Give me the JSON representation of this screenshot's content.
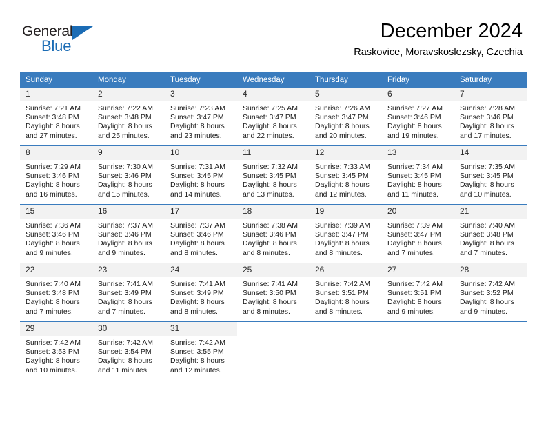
{
  "brand": {
    "name_part1": "General",
    "name_part2": "Blue",
    "accent_color": "#1b6cb5"
  },
  "header": {
    "title": "December 2024",
    "subtitle": "Raskovice, Moravskoslezsky, Czechia"
  },
  "calendar": {
    "header_color": "#3a7cbe",
    "daynum_band_color": "#f2f2f2",
    "weekday_names": [
      "Sunday",
      "Monday",
      "Tuesday",
      "Wednesday",
      "Thursday",
      "Friday",
      "Saturday"
    ],
    "weeks": [
      [
        {
          "day": "1",
          "sunrise": "Sunrise: 7:21 AM",
          "sunset": "Sunset: 3:48 PM",
          "daylight1": "Daylight: 8 hours",
          "daylight2": "and 27 minutes."
        },
        {
          "day": "2",
          "sunrise": "Sunrise: 7:22 AM",
          "sunset": "Sunset: 3:48 PM",
          "daylight1": "Daylight: 8 hours",
          "daylight2": "and 25 minutes."
        },
        {
          "day": "3",
          "sunrise": "Sunrise: 7:23 AM",
          "sunset": "Sunset: 3:47 PM",
          "daylight1": "Daylight: 8 hours",
          "daylight2": "and 23 minutes."
        },
        {
          "day": "4",
          "sunrise": "Sunrise: 7:25 AM",
          "sunset": "Sunset: 3:47 PM",
          "daylight1": "Daylight: 8 hours",
          "daylight2": "and 22 minutes."
        },
        {
          "day": "5",
          "sunrise": "Sunrise: 7:26 AM",
          "sunset": "Sunset: 3:47 PM",
          "daylight1": "Daylight: 8 hours",
          "daylight2": "and 20 minutes."
        },
        {
          "day": "6",
          "sunrise": "Sunrise: 7:27 AM",
          "sunset": "Sunset: 3:46 PM",
          "daylight1": "Daylight: 8 hours",
          "daylight2": "and 19 minutes."
        },
        {
          "day": "7",
          "sunrise": "Sunrise: 7:28 AM",
          "sunset": "Sunset: 3:46 PM",
          "daylight1": "Daylight: 8 hours",
          "daylight2": "and 17 minutes."
        }
      ],
      [
        {
          "day": "8",
          "sunrise": "Sunrise: 7:29 AM",
          "sunset": "Sunset: 3:46 PM",
          "daylight1": "Daylight: 8 hours",
          "daylight2": "and 16 minutes."
        },
        {
          "day": "9",
          "sunrise": "Sunrise: 7:30 AM",
          "sunset": "Sunset: 3:46 PM",
          "daylight1": "Daylight: 8 hours",
          "daylight2": "and 15 minutes."
        },
        {
          "day": "10",
          "sunrise": "Sunrise: 7:31 AM",
          "sunset": "Sunset: 3:45 PM",
          "daylight1": "Daylight: 8 hours",
          "daylight2": "and 14 minutes."
        },
        {
          "day": "11",
          "sunrise": "Sunrise: 7:32 AM",
          "sunset": "Sunset: 3:45 PM",
          "daylight1": "Daylight: 8 hours",
          "daylight2": "and 13 minutes."
        },
        {
          "day": "12",
          "sunrise": "Sunrise: 7:33 AM",
          "sunset": "Sunset: 3:45 PM",
          "daylight1": "Daylight: 8 hours",
          "daylight2": "and 12 minutes."
        },
        {
          "day": "13",
          "sunrise": "Sunrise: 7:34 AM",
          "sunset": "Sunset: 3:45 PM",
          "daylight1": "Daylight: 8 hours",
          "daylight2": "and 11 minutes."
        },
        {
          "day": "14",
          "sunrise": "Sunrise: 7:35 AM",
          "sunset": "Sunset: 3:45 PM",
          "daylight1": "Daylight: 8 hours",
          "daylight2": "and 10 minutes."
        }
      ],
      [
        {
          "day": "15",
          "sunrise": "Sunrise: 7:36 AM",
          "sunset": "Sunset: 3:46 PM",
          "daylight1": "Daylight: 8 hours",
          "daylight2": "and 9 minutes."
        },
        {
          "day": "16",
          "sunrise": "Sunrise: 7:37 AM",
          "sunset": "Sunset: 3:46 PM",
          "daylight1": "Daylight: 8 hours",
          "daylight2": "and 9 minutes."
        },
        {
          "day": "17",
          "sunrise": "Sunrise: 7:37 AM",
          "sunset": "Sunset: 3:46 PM",
          "daylight1": "Daylight: 8 hours",
          "daylight2": "and 8 minutes."
        },
        {
          "day": "18",
          "sunrise": "Sunrise: 7:38 AM",
          "sunset": "Sunset: 3:46 PM",
          "daylight1": "Daylight: 8 hours",
          "daylight2": "and 8 minutes."
        },
        {
          "day": "19",
          "sunrise": "Sunrise: 7:39 AM",
          "sunset": "Sunset: 3:47 PM",
          "daylight1": "Daylight: 8 hours",
          "daylight2": "and 8 minutes."
        },
        {
          "day": "20",
          "sunrise": "Sunrise: 7:39 AM",
          "sunset": "Sunset: 3:47 PM",
          "daylight1": "Daylight: 8 hours",
          "daylight2": "and 7 minutes."
        },
        {
          "day": "21",
          "sunrise": "Sunrise: 7:40 AM",
          "sunset": "Sunset: 3:48 PM",
          "daylight1": "Daylight: 8 hours",
          "daylight2": "and 7 minutes."
        }
      ],
      [
        {
          "day": "22",
          "sunrise": "Sunrise: 7:40 AM",
          "sunset": "Sunset: 3:48 PM",
          "daylight1": "Daylight: 8 hours",
          "daylight2": "and 7 minutes."
        },
        {
          "day": "23",
          "sunrise": "Sunrise: 7:41 AM",
          "sunset": "Sunset: 3:49 PM",
          "daylight1": "Daylight: 8 hours",
          "daylight2": "and 7 minutes."
        },
        {
          "day": "24",
          "sunrise": "Sunrise: 7:41 AM",
          "sunset": "Sunset: 3:49 PM",
          "daylight1": "Daylight: 8 hours",
          "daylight2": "and 8 minutes."
        },
        {
          "day": "25",
          "sunrise": "Sunrise: 7:41 AM",
          "sunset": "Sunset: 3:50 PM",
          "daylight1": "Daylight: 8 hours",
          "daylight2": "and 8 minutes."
        },
        {
          "day": "26",
          "sunrise": "Sunrise: 7:42 AM",
          "sunset": "Sunset: 3:51 PM",
          "daylight1": "Daylight: 8 hours",
          "daylight2": "and 8 minutes."
        },
        {
          "day": "27",
          "sunrise": "Sunrise: 7:42 AM",
          "sunset": "Sunset: 3:51 PM",
          "daylight1": "Daylight: 8 hours",
          "daylight2": "and 9 minutes."
        },
        {
          "day": "28",
          "sunrise": "Sunrise: 7:42 AM",
          "sunset": "Sunset: 3:52 PM",
          "daylight1": "Daylight: 8 hours",
          "daylight2": "and 9 minutes."
        }
      ],
      [
        {
          "day": "29",
          "sunrise": "Sunrise: 7:42 AM",
          "sunset": "Sunset: 3:53 PM",
          "daylight1": "Daylight: 8 hours",
          "daylight2": "and 10 minutes."
        },
        {
          "day": "30",
          "sunrise": "Sunrise: 7:42 AM",
          "sunset": "Sunset: 3:54 PM",
          "daylight1": "Daylight: 8 hours",
          "daylight2": "and 11 minutes."
        },
        {
          "day": "31",
          "sunrise": "Sunrise: 7:42 AM",
          "sunset": "Sunset: 3:55 PM",
          "daylight1": "Daylight: 8 hours",
          "daylight2": "and 12 minutes."
        },
        {
          "day": "",
          "sunrise": "",
          "sunset": "",
          "daylight1": "",
          "daylight2": ""
        },
        {
          "day": "",
          "sunrise": "",
          "sunset": "",
          "daylight1": "",
          "daylight2": ""
        },
        {
          "day": "",
          "sunrise": "",
          "sunset": "",
          "daylight1": "",
          "daylight2": ""
        },
        {
          "day": "",
          "sunrise": "",
          "sunset": "",
          "daylight1": "",
          "daylight2": ""
        }
      ]
    ]
  }
}
